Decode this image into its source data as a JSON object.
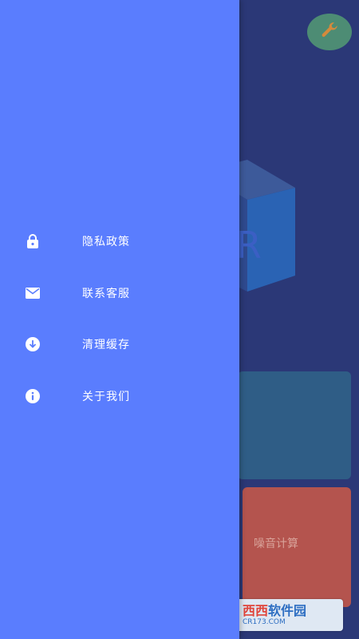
{
  "colors": {
    "drawer_bg": "#5a7dfe",
    "overlay_bg": "#2b3877",
    "menu_text": "#ffffff"
  },
  "drawer": {
    "items": [
      {
        "label": "隐私政策",
        "icon": "lock-icon"
      },
      {
        "label": "联系客服",
        "icon": "mail-icon"
      },
      {
        "label": "清理缓存",
        "icon": "download-circle-icon"
      },
      {
        "label": "关于我们",
        "icon": "info-icon"
      }
    ]
  },
  "background": {
    "wrench_icon": "wrench-icon",
    "card_label": "噪音计算",
    "cube_letter": "R"
  },
  "watermark": {
    "brand": "西西软件园",
    "brand_red": "西西",
    "brand_blue": "软件园",
    "site": "CR173.COM"
  }
}
